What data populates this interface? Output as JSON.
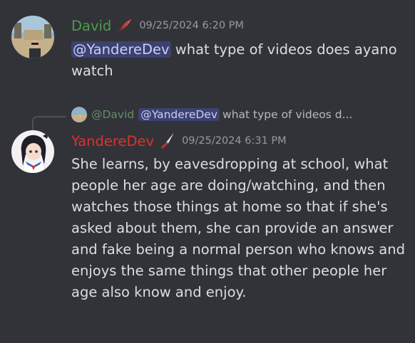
{
  "messages": [
    {
      "username": "David",
      "username_color": "#4e9a4e",
      "role_icon": "feather-icon",
      "timestamp": "09/25/2024 6:20 PM",
      "mention": "@YandereDev",
      "text": " what type of videos does ayano watch"
    },
    {
      "username": "YandereDev",
      "username_color": "#e0302b",
      "role_icon": "knife-icon",
      "timestamp": "09/25/2024 6:31 PM",
      "text": "She learns, by eavesdropping at school, what people her age are doing/watching, and then watches those things at home so that if she's asked about them, she can provide an answer and fake being a normal person who knows and enjoys the same things that other people her age also know and enjoy.",
      "reply": {
        "username": "@David",
        "mention": "@YandereDev",
        "preview": "what type of videos d..."
      }
    }
  ],
  "colors": {
    "background": "#323339",
    "mention_bg": "#3c4270",
    "mention_fg": "#c9cdfb",
    "timestamp": "#949ba4"
  }
}
